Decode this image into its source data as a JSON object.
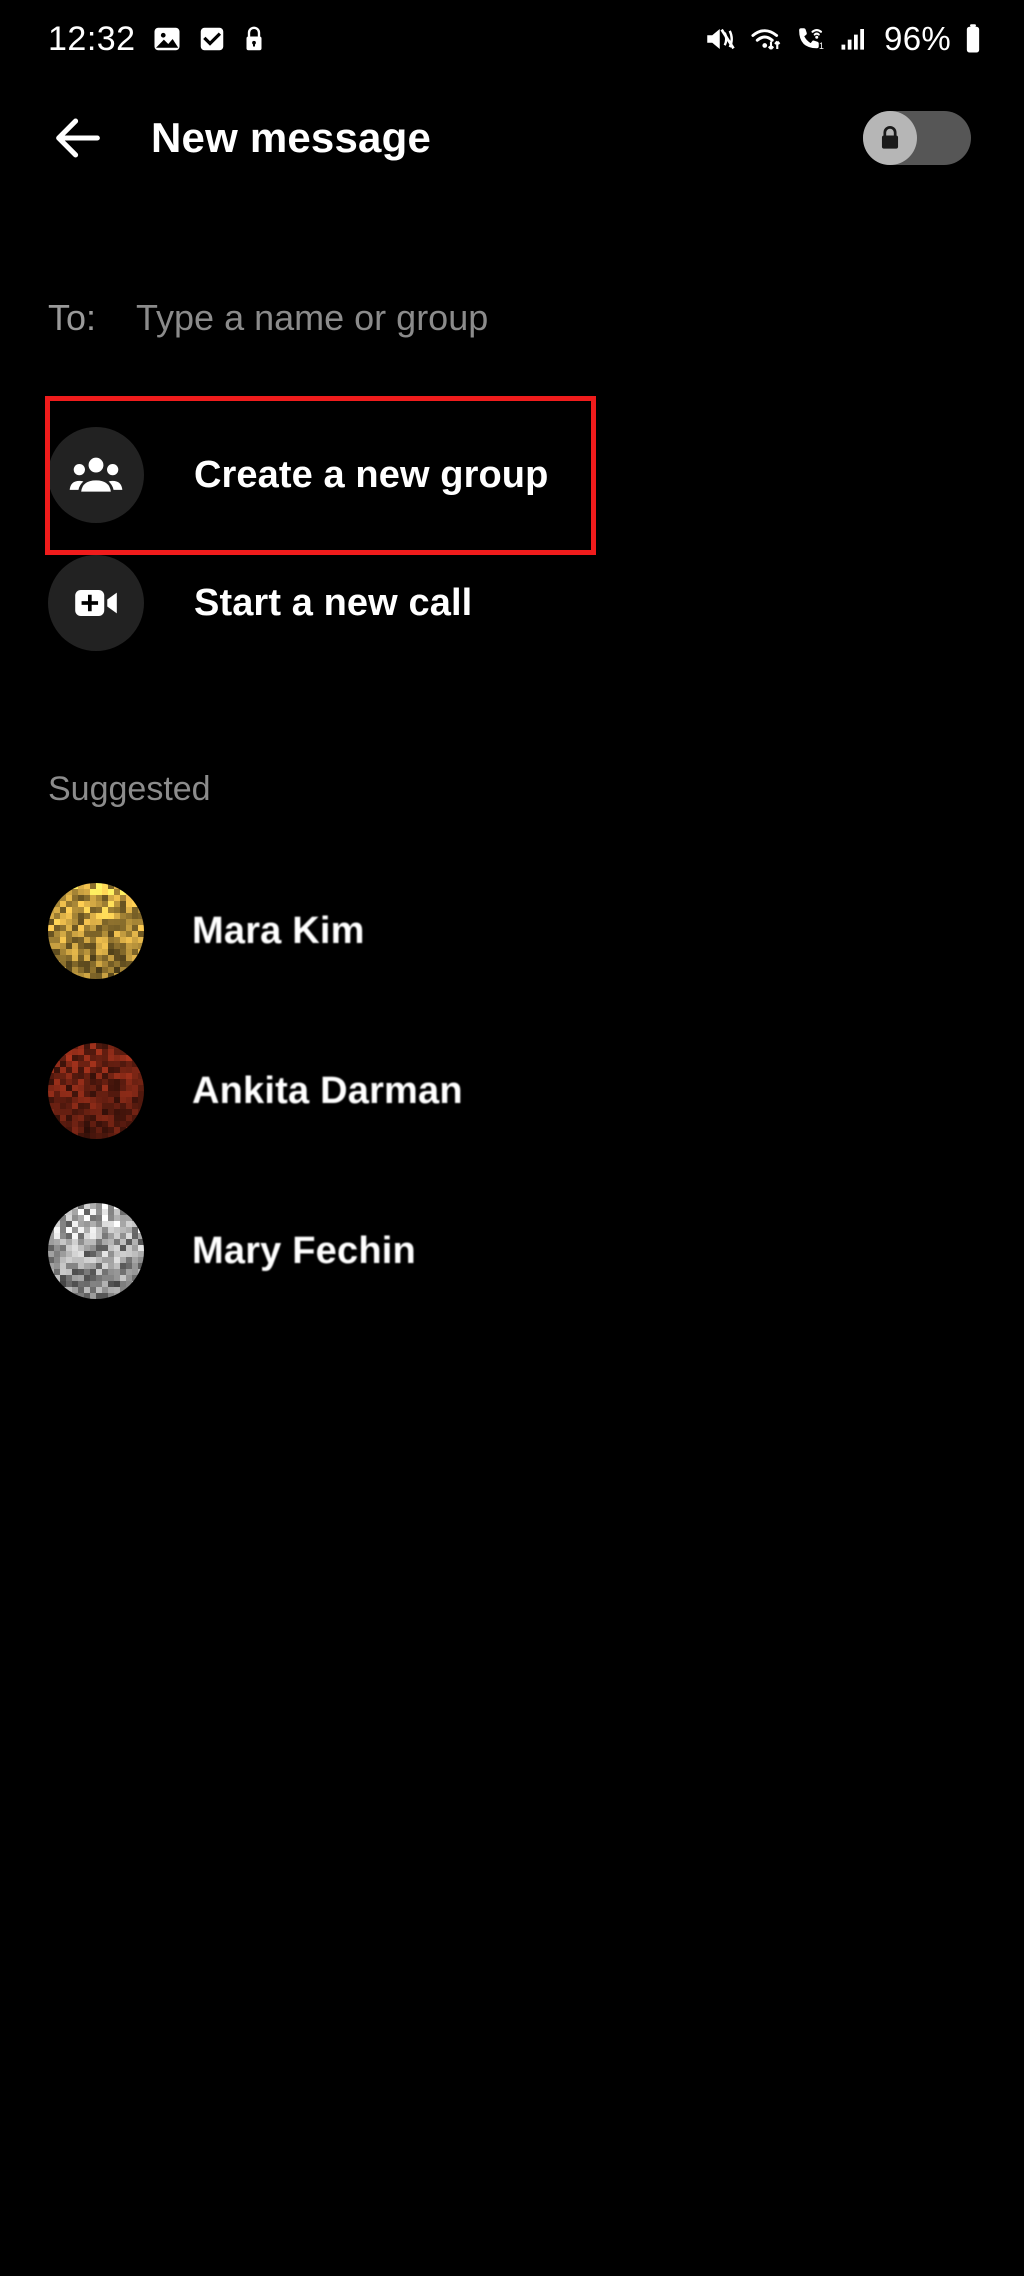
{
  "status_bar": {
    "time": "12:32",
    "battery_percent": "96%",
    "left_icons": [
      "image-icon",
      "checkbox-checked-icon",
      "lock-icon"
    ],
    "right_icons": [
      "mute-vibrate-icon",
      "wifi-icon",
      "wifi-calling-icon",
      "signal-bars-icon",
      "battery-icon"
    ]
  },
  "app_bar": {
    "back_icon": "back-arrow-icon",
    "title": "New message",
    "toggle": {
      "name": "encryption-lock-toggle",
      "state": "off",
      "icon": "lock-icon",
      "track_color": "#565656",
      "knob_color": "#b6b6b6"
    }
  },
  "recipient_field": {
    "label": "To:",
    "value": "",
    "placeholder": "Type a name or group"
  },
  "actions": [
    {
      "id": "create-group",
      "label": "Create a new group",
      "icon": "group-people-icon",
      "highlighted": true
    },
    {
      "id": "start-call",
      "label": "Start a new call",
      "icon": "video-call-add-icon",
      "highlighted": false
    }
  ],
  "suggested": {
    "title": "Suggested",
    "contacts": [
      {
        "name": "Mara Kim",
        "avatar_color": "#f0c04e",
        "avatar_style": "yellow-pixelated"
      },
      {
        "name": "Ankita Darman",
        "avatar_color": "#8c2b18",
        "avatar_style": "red-pixelated"
      },
      {
        "name": "Mary Fechin",
        "avatar_color": "#d8d8d8",
        "avatar_style": "gray-pixelated"
      }
    ]
  },
  "annotation": {
    "target": "create-group",
    "color": "#f01c1c"
  },
  "theme": {
    "background": "#000000",
    "text_primary": "#ffffff",
    "text_secondary": "#8c8c8c",
    "icon_circle": "#222222"
  }
}
